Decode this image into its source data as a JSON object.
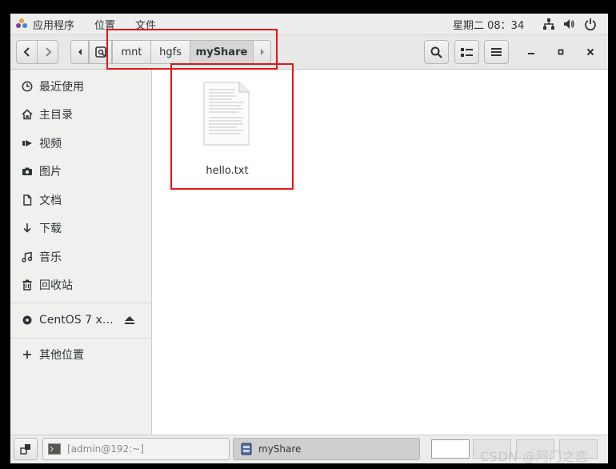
{
  "topbar": {
    "applications": "应用程序",
    "places": "位置",
    "files": "文件",
    "clock": "星期二 08：34"
  },
  "header": {
    "breadcrumbs": [
      "mnt",
      "hgfs",
      "myShare"
    ]
  },
  "sidebar": {
    "items": [
      {
        "label": "最近使用",
        "icon": "clock-icon"
      },
      {
        "label": "主目录",
        "icon": "home-icon"
      },
      {
        "label": "视频",
        "icon": "video-icon"
      },
      {
        "label": "图片",
        "icon": "camera-icon"
      },
      {
        "label": "文档",
        "icon": "document-icon"
      },
      {
        "label": "下载",
        "icon": "download-icon"
      },
      {
        "label": "音乐",
        "icon": "music-icon"
      },
      {
        "label": "回收站",
        "icon": "trash-icon"
      }
    ],
    "device": {
      "label": "CentOS 7 x…",
      "icon": "disc-icon"
    },
    "other": {
      "label": "其他位置",
      "icon": "plus-icon"
    }
  },
  "files": [
    {
      "name": "hello.txt",
      "icon": "text-file-icon"
    }
  ],
  "taskbar": {
    "terminal": "[admin@192:~]",
    "files": "myShare"
  },
  "watermark": "CSDN @阿门之恋",
  "colors": {
    "annotation": "#e0161b",
    "selected_crumb": "#d6d6d5"
  }
}
